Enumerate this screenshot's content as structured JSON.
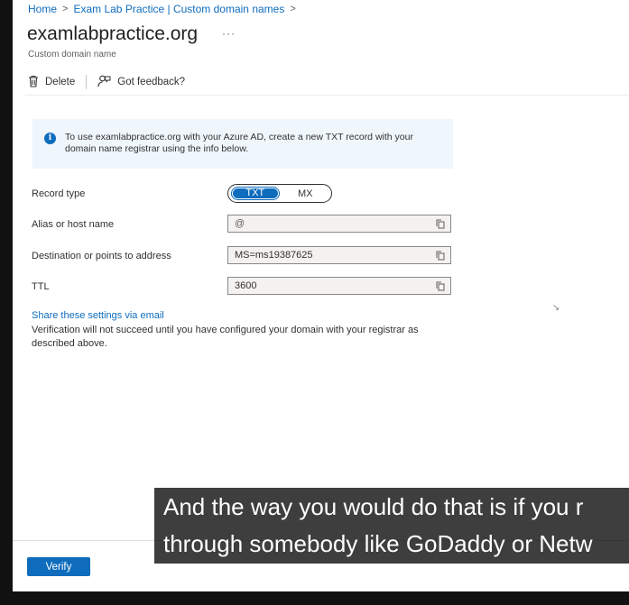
{
  "breadcrumb": {
    "home": "Home",
    "current": "Exam Lab Practice | Custom domain names"
  },
  "header": {
    "title": "examlabpractice.org",
    "more": "···",
    "subtitle": "Custom domain name"
  },
  "toolbar": {
    "delete_label": "Delete",
    "feedback_label": "Got feedback?"
  },
  "info": {
    "message": "To use examlabpractice.org with your Azure AD, create a new TXT record with your domain name registrar using the info below."
  },
  "form": {
    "record_type_label": "Record type",
    "record_type_options": [
      "TXT",
      "MX"
    ],
    "record_type_selected": "TXT",
    "alias_label": "Alias or host name",
    "alias_value": "@",
    "destination_label": "Destination or points to address",
    "destination_value": "MS=ms19387625",
    "ttl_label": "TTL",
    "ttl_value": "3600"
  },
  "share_link": "Share these settings via email",
  "verify_note": "Verification will not succeed until you have configured your domain with your registrar as described above.",
  "verify_button": "Verify",
  "caption": {
    "line1": "And the way you would do that is if you r",
    "line2": "through somebody like GoDaddy or Netw"
  },
  "colors": {
    "accent": "#0f6cbd",
    "info_bg": "#eff6fc"
  }
}
